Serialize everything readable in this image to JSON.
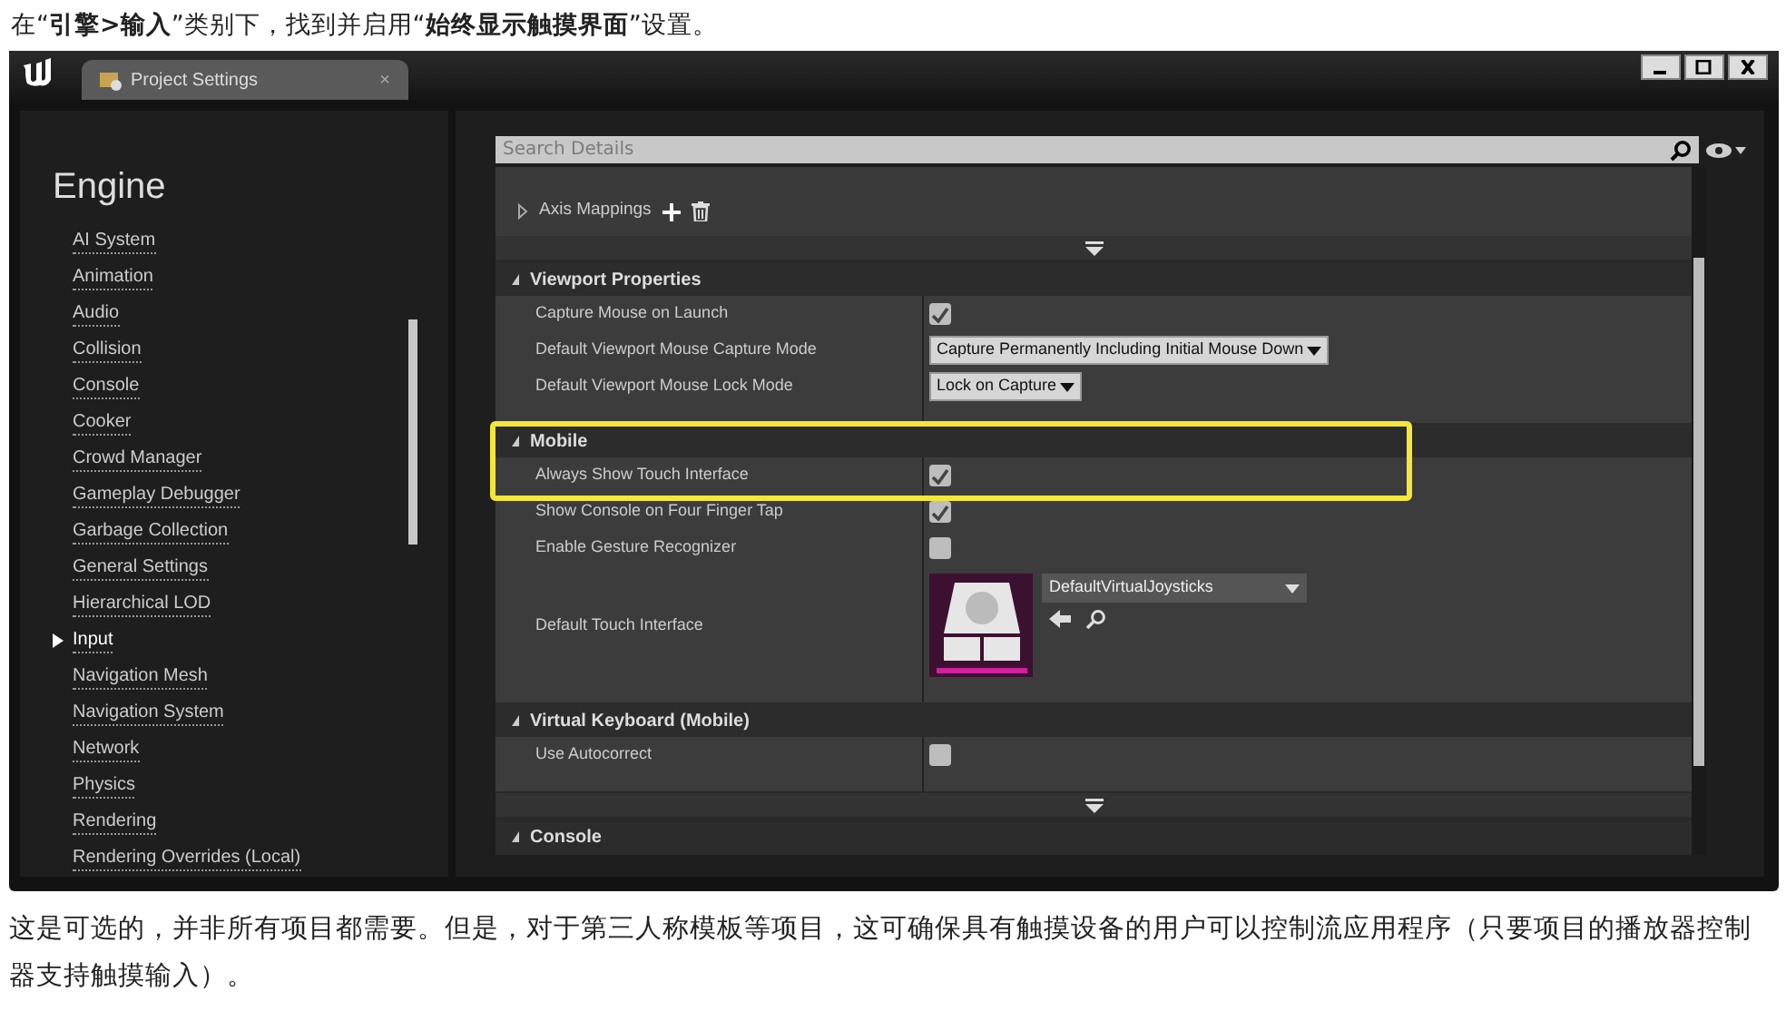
{
  "caption": "在“**引擎>输入**”类别下，找到并启用“**始终显示触摸界面**”设置。",
  "window": {
    "tab": {
      "title": "Project Settings",
      "close": "×"
    }
  },
  "sidebar": {
    "heading": "Engine",
    "items": [
      {
        "label": "AI System",
        "selected": false
      },
      {
        "label": "Animation",
        "selected": false
      },
      {
        "label": "Audio",
        "selected": false
      },
      {
        "label": "Collision",
        "selected": false
      },
      {
        "label": "Console",
        "selected": false
      },
      {
        "label": "Cooker",
        "selected": false
      },
      {
        "label": "Crowd Manager",
        "selected": false
      },
      {
        "label": "Gameplay Debugger",
        "selected": false
      },
      {
        "label": "Garbage Collection",
        "selected": false
      },
      {
        "label": "General Settings",
        "selected": false
      },
      {
        "label": "Hierarchical LOD",
        "selected": false
      },
      {
        "label": "Input",
        "selected": true
      },
      {
        "label": "Navigation Mesh",
        "selected": false
      },
      {
        "label": "Navigation System",
        "selected": false
      },
      {
        "label": "Network",
        "selected": false
      },
      {
        "label": "Physics",
        "selected": false
      },
      {
        "label": "Rendering",
        "selected": false
      },
      {
        "label": "Rendering Overrides (Local)",
        "selected": false
      }
    ]
  },
  "search": {
    "placeholder": "Search Details"
  },
  "details": [
    {
      "kind": "mappings",
      "rows": [
        {
          "label": "Axis Mappings"
        }
      ]
    },
    {
      "kind": "expander"
    },
    {
      "kind": "section",
      "title": "Viewport Properties",
      "highlighted": false,
      "rows": [
        {
          "kind": "checkbox",
          "label": "Capture Mouse on Launch",
          "checked": true
        },
        {
          "kind": "combo",
          "label": "Default Viewport Mouse Capture Mode",
          "value": "Capture Permanently Including Initial Mouse Down"
        },
        {
          "kind": "combo",
          "label": "Default Viewport Mouse Lock Mode",
          "value": "Lock on Capture"
        }
      ]
    },
    {
      "kind": "section",
      "title": "Mobile",
      "highlighted": true,
      "rows": [
        {
          "kind": "checkbox",
          "label": "Always Show Touch Interface",
          "checked": true
        },
        {
          "kind": "checkbox",
          "label": "Show Console on Four Finger Tap",
          "checked": true
        },
        {
          "kind": "checkbox",
          "label": "Enable Gesture Recognizer",
          "checked": false
        },
        {
          "kind": "asset",
          "label": "Default Touch Interface",
          "value": "DefaultVirtualJoysticks"
        }
      ]
    },
    {
      "kind": "section",
      "title": "Virtual Keyboard (Mobile)",
      "highlighted": false,
      "rows": [
        {
          "kind": "checkbox",
          "label": "Use Autocorrect",
          "checked": false
        }
      ]
    },
    {
      "kind": "expander"
    },
    {
      "kind": "section",
      "title": "Console",
      "highlighted": false
    }
  ],
  "paragraph": "这是可选的，并非所有项目都需要。但是，对于第三人称模板等项目，这可确保具有触摸设备的用户可以控制流应用程序（只要项目的播放器控制器支持触摸输入）。"
}
